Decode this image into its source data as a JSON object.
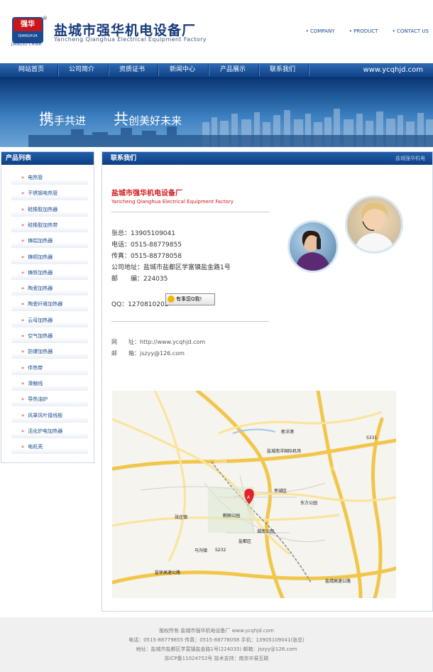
{
  "header": {
    "logo_cn": "强华",
    "logo_en": "QIANGHUA",
    "logo_reg": "®",
    "logo_caption": "JIANGSU CHINA",
    "title": "盐城市强华机电设备厂",
    "subtitle": "Yancheng  Qianghua Electrical Equipment Factory",
    "top_links": [
      "• COMPANY",
      "• PRODUCT",
      "• CONTACT US"
    ]
  },
  "nav": {
    "items": [
      "网站首页",
      "公司简介",
      "资质证书",
      "新闻中心",
      "产品展示",
      "联系我们"
    ],
    "domain": "www.ycqhjd.com"
  },
  "banner": {
    "slogan1_big": "携",
    "slogan1_rest": "手共进",
    "slogan2_big": "共",
    "slogan2_rest": "创美好未来"
  },
  "sidebar": {
    "title": "产品列表",
    "items": [
      "电热管",
      "不锈钢电热管",
      "硅橡胶加热器",
      "硅橡胶加热带",
      "铸铝加热器",
      "铸铜加热器",
      "铸铁加热器",
      "陶瓷加热器",
      "陶瓷纤维加热器",
      "云母加热器",
      "空气加热器",
      "防爆加热器",
      "伴热带",
      "滑触线",
      "导热油炉",
      "风罩风叶接线板",
      "活化炉电加热器",
      "电机壳"
    ]
  },
  "main": {
    "title": "联系我们",
    "crumb": "盐城强华机电",
    "company_cn": "盐城市强华机电设备厂",
    "company_en": "Yancheng Qianghua Electrical Equipment Factory",
    "contacts": [
      "张总：13905109041",
      "电话：0515-88779855",
      "传真：0515-88778058",
      "公司地址：盐城市盐都区学富镇盐金路1号",
      "邮　　编：224035"
    ],
    "qq": "QQ：1270810202",
    "qq_button": "有事您Q我!",
    "website": "网　　址：http://www.ycqhjd.com",
    "email": "邮　　箱：jszyy@126.com"
  },
  "map": {
    "labels": [
      "新洋港",
      "盐城南洋国际机场",
      "亭湖区",
      "东方公园",
      "张庄镇",
      "鹤翔公园",
      "城南公园",
      "盐都区",
      "马沟镇",
      "G204",
      "G15",
      "S331",
      "S232",
      "盐徐高速公路",
      "盐靖高速公路",
      "新洋港"
    ],
    "marker": "A"
  },
  "footer": {
    "lines": [
      "版权所有  盐城市强华机电设备厂  www.ycqhjd.com",
      "电话：0515-88779855  传真：0515-88778058  手机：13905109041(张总)",
      "地址：盐城市盐都区学富镇盐金路1号(224035)  邮箱：jszyy@126.com",
      "苏ICP备11024752号  技术支持：南京中易互联"
    ]
  },
  "colors": {
    "nav_blue": "#0e3f85",
    "title_blue": "#173a7a",
    "accent_red": "#d0191d",
    "footer_bg": "#f0f0f0"
  }
}
